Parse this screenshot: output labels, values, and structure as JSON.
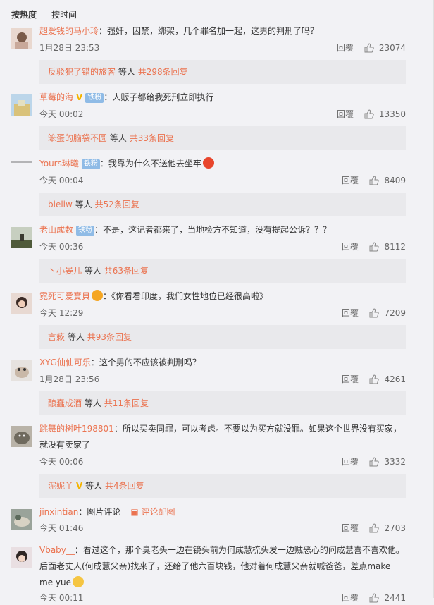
{
  "sort": {
    "hot": "按热度",
    "time": "按时间"
  },
  "reply_label": "回覆",
  "replies_suffix": "等人",
  "comments": [
    {
      "user": "超爱钱的马小玲",
      "text": "：强奸，囚禁，绑架，几个罪名加一起，这男的判刑了吗？",
      "time": "1月28日 23:53",
      "likes": "23074",
      "reply_user": "反驳犯了错的旅客",
      "reply_count": "共298条回复"
    },
    {
      "user": "草莓的海",
      "vbadge": "V",
      "badge": "铁粉",
      "text": "：人贩子都给我死刑立即执行",
      "time": "今天 00:02",
      "likes": "13350",
      "reply_user": "笨蛋的脑袋不圆",
      "reply_count": "共33条回复"
    },
    {
      "user": "Yours琳曦",
      "badge": "铁粉",
      "text": "：我靠为什么不送他去坐牢",
      "time": "今天 00:04",
      "likes": "8409",
      "reply_user": "bieliw",
      "reply_count": "共52条回复"
    },
    {
      "user": "老山成数",
      "badge": "铁粉",
      "text": "：不是，这记者都来了，当地检方不知道，没有提起公诉？？？",
      "time": "今天 00:36",
      "likes": "8112",
      "reply_user": "丶小晏儿",
      "reply_count": "共63条回复"
    },
    {
      "user": "霓死可爱寶貝",
      "text": "：《你看看印度，我们女性地位已经很高啦》",
      "time": "今天 12:29",
      "likes": "7209",
      "reply_user": "言簌",
      "reply_count": "共93条回复"
    },
    {
      "user": "XYG仙仙可乐",
      "text": "：这个男的不应该被判刑吗？",
      "time": "1月28日 23:56",
      "likes": "4261",
      "reply_user": "酿蠢成酒",
      "reply_count": "共11条回复"
    },
    {
      "user": "跳舞的树叶198801",
      "text": "：所以买卖同罪，可以考虑。不要以为买方就没罪。如果这个世界没有买家，就没有卖家了",
      "time": "今天 00:06",
      "likes": "3332",
      "reply_user": "泥妮丫",
      "reply_count": "共4条回复"
    },
    {
      "user": "jinxintian",
      "text": "：图片评论",
      "review_link": "评论配图",
      "time": "今天 01:46",
      "likes": "2703"
    },
    {
      "user": "Vbaby__",
      "text": "：看过这个，那个臭老头一边在镜头前为何成慧梳头发一边贼恶心的问成慧喜不喜欢他。后面老丈人(何成慧父亲)找来了，还给了他六百块钱，他对着何成慧父亲就喊爸爸，差点make me yue",
      "time": "今天 00:11",
      "likes": "2441"
    }
  ]
}
